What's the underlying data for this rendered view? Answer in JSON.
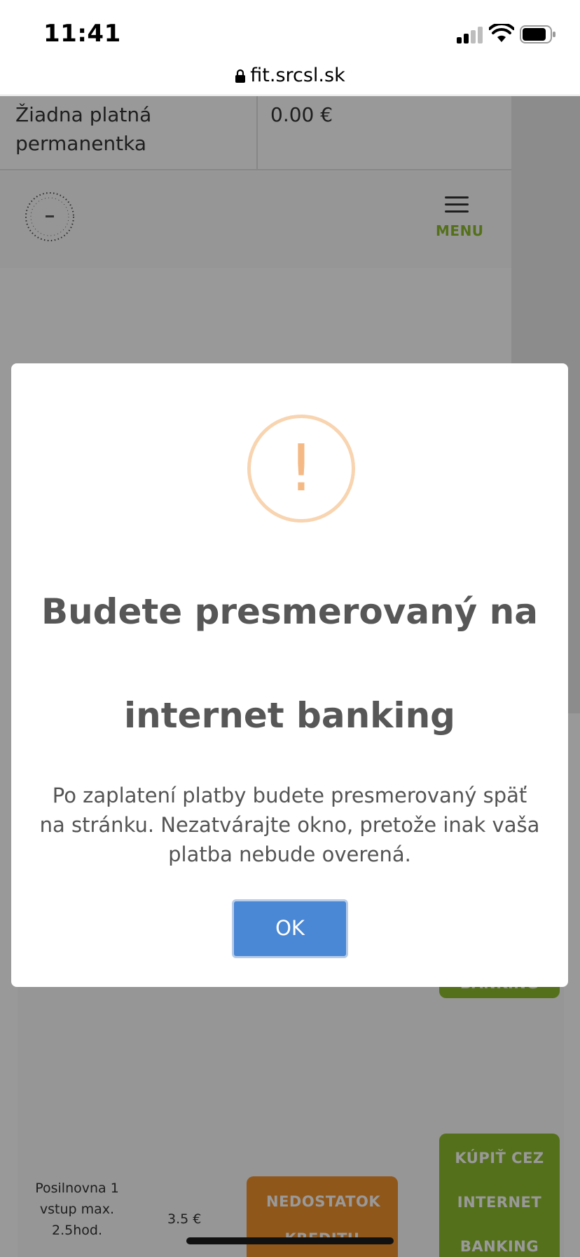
{
  "status_bar": {
    "time": "11:41",
    "signal_icon": "cellular-signal",
    "wifi_icon": "wifi",
    "battery_icon": "battery"
  },
  "url_bar": {
    "lock_icon": "lock",
    "domain": "fit.srcsl.sk"
  },
  "page": {
    "pass_row": {
      "name": "Žiadna platná permanentka",
      "price": "0.00 €"
    },
    "header": {
      "menu_label": "MENU"
    },
    "items": [
      {
        "name": "Posilnovna 1 vstup max. 2.5hod.",
        "price": "3.5 €",
        "credit_button": "NEDOSTATOK KREDITU",
        "bank_button": "KÚPIŤ CEZ INTERNET BANKING"
      }
    ],
    "partial_button_text": "BANKING"
  },
  "modal": {
    "icon": "exclamation-warning",
    "icon_glyph": "!",
    "title": "Budete presmerovaný na internet banking",
    "text": "Po zaplatení platby budete presmerovaný späť na stránku. Nezatvárajte okno, pretože inak vaša platba nebude overená.",
    "ok_label": "OK"
  },
  "colors": {
    "accent_green": "#8dbb2e",
    "accent_orange": "#f0912d",
    "ok_blue": "#4a87d4",
    "warning_ring": "#f8d4b0"
  }
}
